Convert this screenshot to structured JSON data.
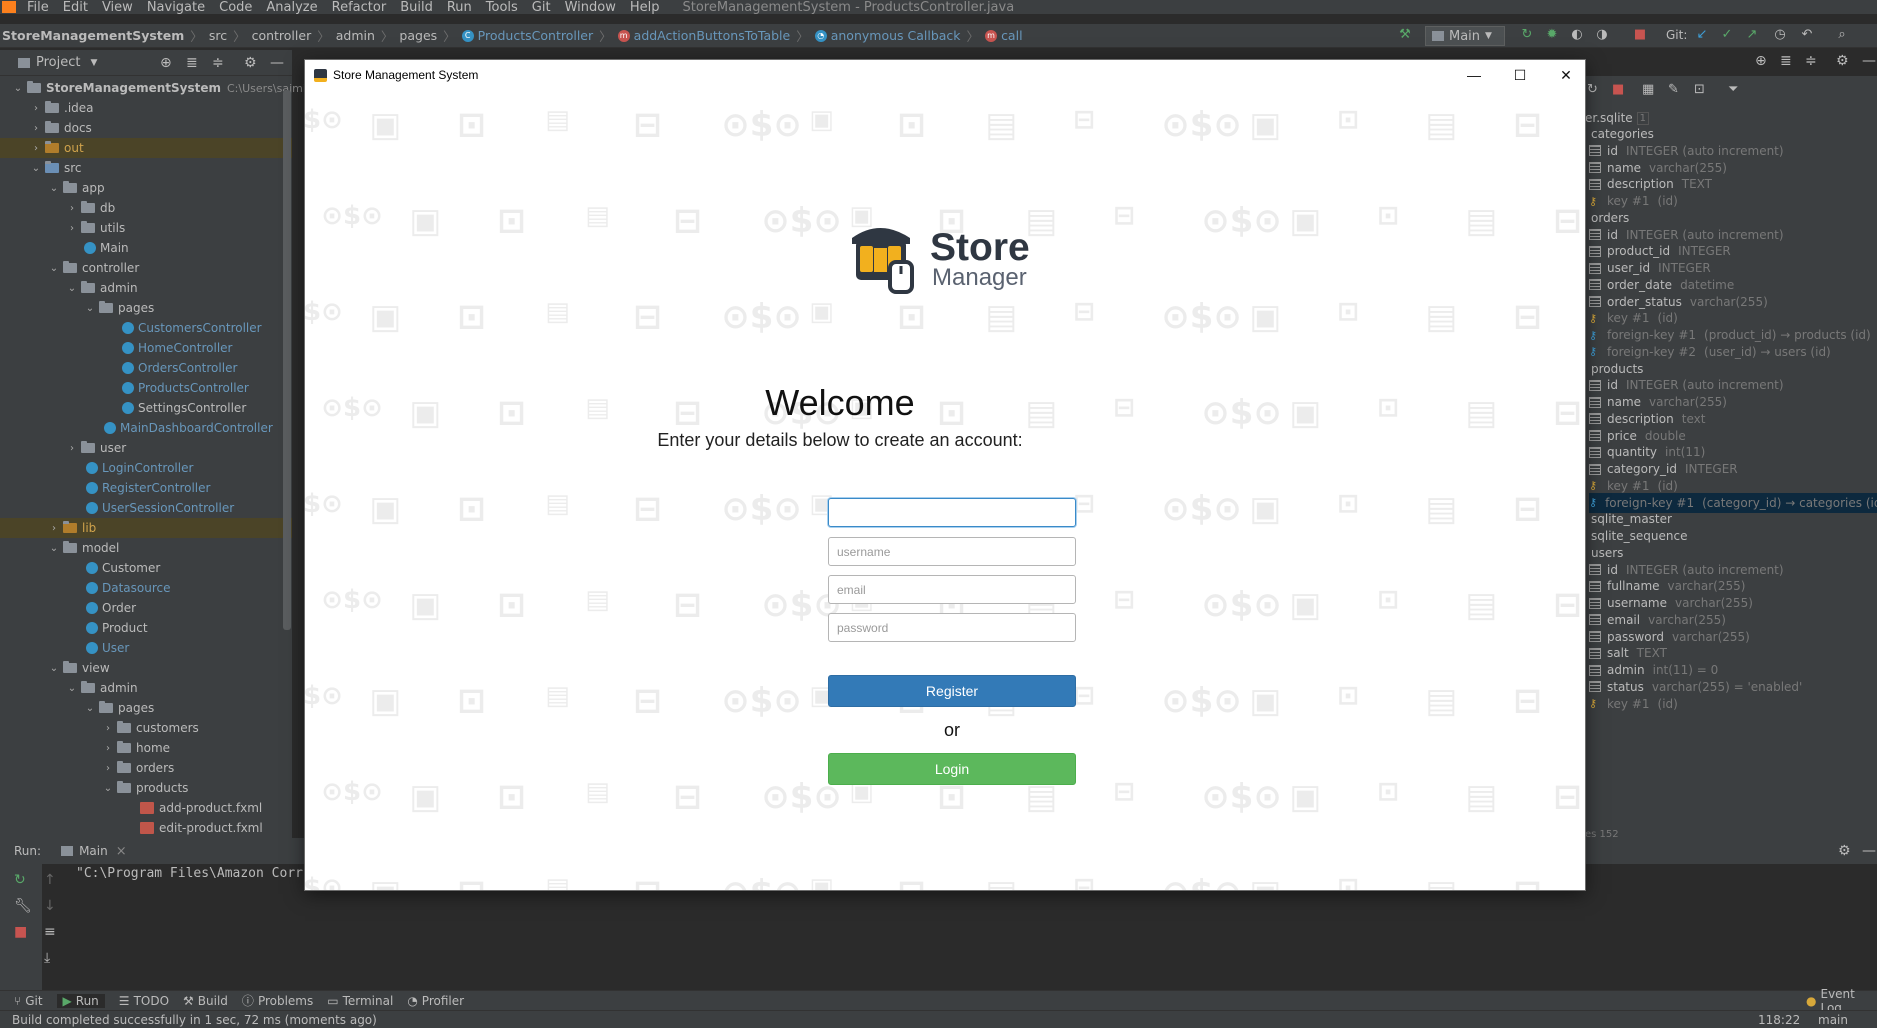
{
  "ide": {
    "menu": [
      "File",
      "Edit",
      "View",
      "Navigate",
      "Code",
      "Analyze",
      "Refactor",
      "Build",
      "Run",
      "Tools",
      "Git",
      "Window",
      "Help"
    ],
    "window_title": "StoreManagementSystem - ProductsController.java",
    "breadcrumbs": [
      "StoreManagementSystem",
      "src",
      "controller",
      "admin",
      "pages",
      "ProductsController",
      "addActionButtonsToTable",
      "anonymous Callback",
      "call"
    ],
    "run_config": "Main",
    "git_label": "Git:"
  },
  "project": {
    "header": "Project",
    "root_name": "StoreManagementSystem",
    "root_path": "C:\\Users\\sajmi\\O",
    "items": [
      {
        "label": "idea_label",
        "text": ".idea"
      },
      {
        "text": "docs"
      },
      {
        "text": "out"
      },
      {
        "text": "src"
      },
      {
        "text": "app"
      },
      {
        "text": "db"
      },
      {
        "text": "utils"
      },
      {
        "text": "Main"
      },
      {
        "text": "controller"
      },
      {
        "text": "admin"
      },
      {
        "text": "pages"
      },
      {
        "text": "CustomersController"
      },
      {
        "text": "HomeController"
      },
      {
        "text": "OrdersController"
      },
      {
        "text": "ProductsController"
      },
      {
        "text": "SettingsController"
      },
      {
        "text": "MainDashboardController"
      },
      {
        "text": "user"
      },
      {
        "text": "LoginController"
      },
      {
        "text": "RegisterController"
      },
      {
        "text": "UserSessionController"
      },
      {
        "text": "lib"
      },
      {
        "text": "model"
      },
      {
        "text": "Customer"
      },
      {
        "text": "Datasource"
      },
      {
        "text": "Order"
      },
      {
        "text": "Product"
      },
      {
        "text": "User"
      },
      {
        "text": "view"
      },
      {
        "text": "admin"
      },
      {
        "text": "pages"
      },
      {
        "text": "customers"
      },
      {
        "text": "home"
      },
      {
        "text": "orders"
      },
      {
        "text": "products"
      },
      {
        "text": "add-product.fxml"
      },
      {
        "text": "edit-product.fxml"
      }
    ]
  },
  "database": {
    "file": "er.sqlite",
    "file_count": "1",
    "rows": [
      {
        "kind": "table",
        "name": "categories"
      },
      {
        "kind": "col",
        "name": "id",
        "type": "INTEGER (auto increment)"
      },
      {
        "kind": "col",
        "name": "name",
        "type": "varchar(255)"
      },
      {
        "kind": "col",
        "name": "description",
        "type": "TEXT"
      },
      {
        "kind": "key",
        "name": "key #1",
        "type": "(id)"
      },
      {
        "kind": "table",
        "name": "orders"
      },
      {
        "kind": "col",
        "name": "id",
        "type": "INTEGER (auto increment)"
      },
      {
        "kind": "col",
        "name": "product_id",
        "type": "INTEGER"
      },
      {
        "kind": "col",
        "name": "user_id",
        "type": "INTEGER"
      },
      {
        "kind": "col",
        "name": "order_date",
        "type": "datetime"
      },
      {
        "kind": "col",
        "name": "order_status",
        "type": "varchar(255)"
      },
      {
        "kind": "key",
        "name": "key #1",
        "type": "(id)"
      },
      {
        "kind": "fk",
        "name": "foreign-key #1",
        "type": "(product_id) → products (id)"
      },
      {
        "kind": "fk",
        "name": "foreign-key #2",
        "type": "(user_id) → users (id)"
      },
      {
        "kind": "table",
        "name": "products"
      },
      {
        "kind": "col",
        "name": "id",
        "type": "INTEGER (auto increment)"
      },
      {
        "kind": "col",
        "name": "name",
        "type": "varchar(255)"
      },
      {
        "kind": "col",
        "name": "description",
        "type": "text"
      },
      {
        "kind": "col",
        "name": "price",
        "type": "double"
      },
      {
        "kind": "col",
        "name": "quantity",
        "type": "int(11)"
      },
      {
        "kind": "col",
        "name": "category_id",
        "type": "INTEGER"
      },
      {
        "kind": "key",
        "name": "key #1",
        "type": "(id)"
      },
      {
        "kind": "fk",
        "name": "foreign-key #1",
        "type": "(category_id) → categories (id)",
        "selected": true
      },
      {
        "kind": "table",
        "name": "sqlite_master"
      },
      {
        "kind": "table",
        "name": "sqlite_sequence"
      },
      {
        "kind": "table",
        "name": "users"
      },
      {
        "kind": "col",
        "name": "id",
        "type": "INTEGER (auto increment)"
      },
      {
        "kind": "col",
        "name": "fullname",
        "type": "varchar(255)"
      },
      {
        "kind": "col",
        "name": "username",
        "type": "varchar(255)"
      },
      {
        "kind": "col",
        "name": "email",
        "type": "varchar(255)"
      },
      {
        "kind": "col",
        "name": "password",
        "type": "varchar(255)"
      },
      {
        "kind": "col",
        "name": "salt",
        "type": "TEXT"
      },
      {
        "kind": "col",
        "name": "admin",
        "type": "int(11) = 0"
      },
      {
        "kind": "col",
        "name": "status",
        "type": "varchar(255) = 'enabled'"
      },
      {
        "kind": "key",
        "name": "key #1",
        "type": "(id)"
      }
    ],
    "footer": "es 152"
  },
  "run": {
    "label": "Run:",
    "tab": "Main",
    "command": "\"C:\\Program Files\\Amazon Corr"
  },
  "bottom_tabs": [
    "Git",
    "Run",
    "TODO",
    "Build",
    "Problems",
    "Terminal",
    "Profiler"
  ],
  "event_log": "Event Log",
  "status": {
    "message": "Build completed successfully in 1 sec, 72 ms (moments ago)",
    "position": "118:22",
    "branch": "main"
  },
  "dialog": {
    "title": "Store Management System",
    "logo_word1": "Store",
    "logo_word2": "Manager",
    "welcome": "Welcome",
    "subtitle": "Enter your details below to create an account:",
    "fullname_placeholder": "",
    "username_placeholder": "username",
    "email_placeholder": "email",
    "password_placeholder": "password",
    "register_label": "Register",
    "or_label": "or",
    "login_label": "Login"
  },
  "colors": {
    "register": "#337ab7",
    "login": "#5cb85c",
    "logo_dark": "#2f3742",
    "logo_yellow": "#f2b01e"
  }
}
